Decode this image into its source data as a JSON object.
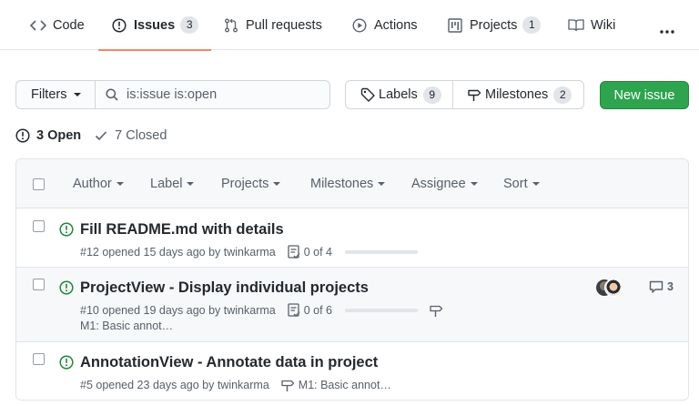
{
  "tabs": [
    {
      "label": "Code",
      "icon": "code-icon"
    },
    {
      "label": "Issues",
      "icon": "issue-opened-icon",
      "count": "3"
    },
    {
      "label": "Pull requests",
      "icon": "git-pull-request-icon"
    },
    {
      "label": "Actions",
      "icon": "play-icon"
    },
    {
      "label": "Projects",
      "icon": "project-icon",
      "count": "1"
    },
    {
      "label": "Wiki",
      "icon": "book-icon"
    }
  ],
  "toolbar": {
    "filters_label": "Filters",
    "search_value": "is:issue is:open",
    "labels_label": "Labels",
    "labels_count": "9",
    "milestones_label": "Milestones",
    "milestones_count": "2",
    "new_issue_label": "New issue"
  },
  "states": {
    "open_label": "3 Open",
    "closed_label": "7 Closed"
  },
  "header": {
    "author": "Author",
    "label": "Label",
    "projects": "Projects",
    "milestones": "Milestones",
    "assignee": "Assignee",
    "sort": "Sort"
  },
  "issues": [
    {
      "title": "Fill README.md with details",
      "meta": "#12 opened 15 days ago by twinkarma",
      "tasks": "0 of 4",
      "tasks_done_fraction": 0
    },
    {
      "title": "ProjectView - Display individual projects",
      "meta": "#10 opened 19 days ago by twinkarma",
      "tasks": "0 of 6",
      "tasks_done_fraction": 0,
      "milestone": "M1: Basic annot…",
      "comments": "3"
    },
    {
      "title": "AnnotationView - Annotate data in project",
      "meta": "#5 opened 23 days ago by twinkarma",
      "milestone": "M1: Basic annot…"
    }
  ],
  "colors": {
    "accent_underline": "#f9826c",
    "open_green": "#22863a",
    "button_green": "#2ea44f",
    "muted_text": "#586069"
  }
}
